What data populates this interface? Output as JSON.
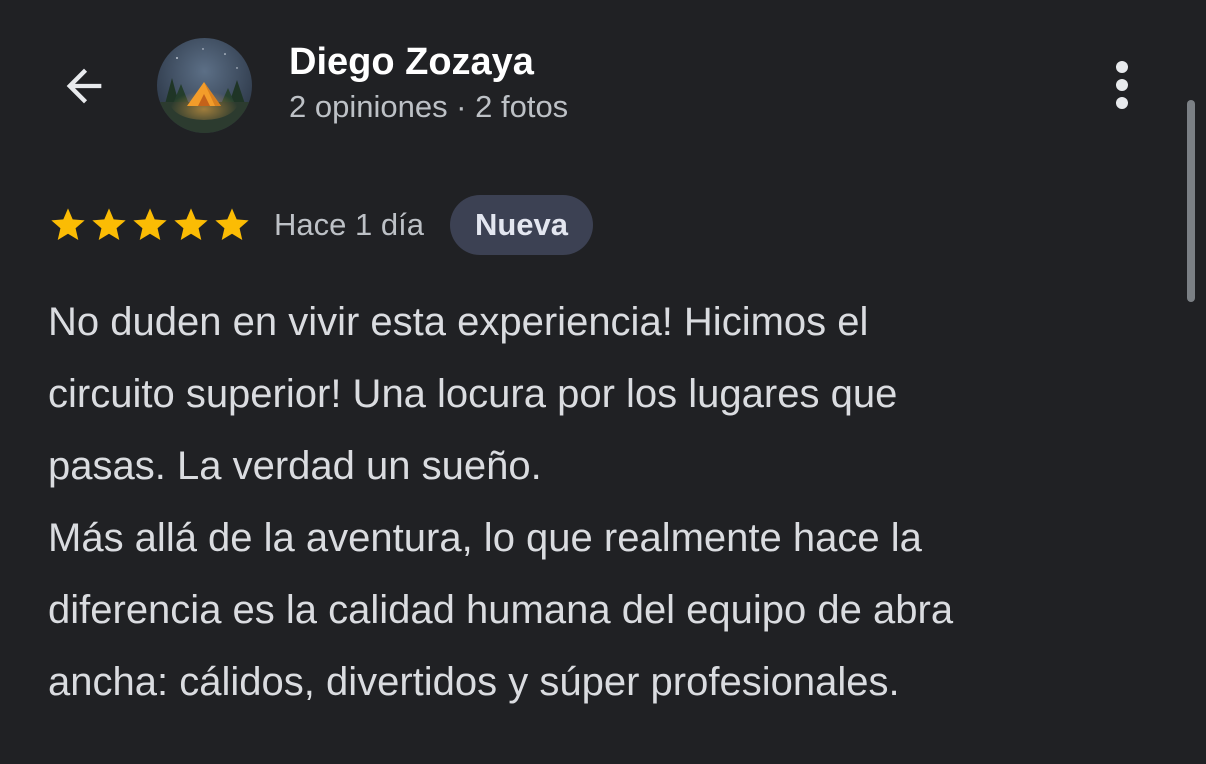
{
  "header": {
    "back_icon": "arrow-back-icon",
    "more_icon": "more-vert-icon",
    "author": {
      "name": "Diego Zozaya",
      "meta": "2 opiniones · 2 fotos",
      "avatar_icon": "tent-at-night-avatar"
    }
  },
  "review": {
    "rating": 5,
    "rating_max": 5,
    "star_color": "#fbbc04",
    "date": "Hace 1 día",
    "badge": "Nueva",
    "lines": [
      "No duden en vivir esta experiencia! Hicimos el",
      "circuito superior! Una locura por los lugares que",
      "pasas. La verdad un sueño.",
      "Más allá de la aventura, lo que realmente hace la",
      "diferencia es la calidad humana del equipo de abra",
      "ancha: cálidos, divertidos y súper profesionales."
    ]
  },
  "colors": {
    "background": "#202124",
    "badge_background": "#3c4153",
    "text_primary": "#ffffff",
    "text_secondary": "#bdc1c6"
  }
}
